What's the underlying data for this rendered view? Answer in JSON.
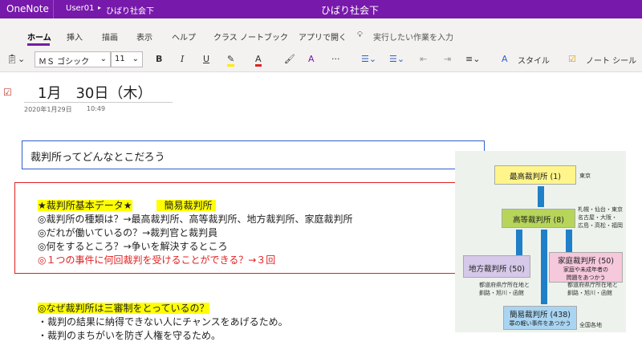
{
  "titlebar": {
    "app": "OneNote",
    "user": "User01",
    "notebook": "ひばり社会下",
    "title": "ひばり社会下"
  },
  "tabs": [
    "ホーム",
    "挿入",
    "描画",
    "表示",
    "ヘルプ",
    "クラス ノートブック",
    "アプリで開く"
  ],
  "search_placeholder": "実行したい作業を入力",
  "toolbar": {
    "font": "ＭＳ ゴシック",
    "size": "11",
    "bold": "B",
    "italic": "I",
    "underline": "U",
    "more": "···",
    "styles": "スタイル",
    "tags": "ノート シール"
  },
  "colors": {
    "accent": "#7719aa",
    "highlight": "#ffff00",
    "red": "#e02020",
    "blue": "#2e5fc9"
  },
  "page": {
    "title": "1月　30日（木）",
    "date": "2020年1月29日",
    "time": "10:49",
    "question": "裁判所ってどんなとこだろう",
    "data_lines": [
      "★裁判所基本データ★",
      "簡易裁判所",
      "◎裁判所の種類は？→最高裁判所、高等裁判所、地方裁判所、家庭裁判所",
      "◎だれが働いているの？→裁判官と裁判員",
      "◎何をするところ？→争いを解決するところ",
      "◎１つの事件に何回裁判を受けることができる？→３回"
    ],
    "why_title": "◎なぜ裁判所は三審制をとっているの？",
    "why_lines": [
      "・裁判の結果に納得できない人にチャンスをあげるため。",
      "・裁判のまちがいを防ぎ人権を守るため。"
    ]
  },
  "diagram": {
    "supreme": "最高裁判所 (1)",
    "supreme_loc": "東京",
    "high": "高等裁判所 (8)",
    "high_loc": [
      "札幌・仙台・東京",
      "名古屋・大阪・",
      "広島・高松・福岡"
    ],
    "district": "地方裁判所 (50)",
    "family": "家庭裁判所 (50)",
    "family_desc": [
      "家庭や未成年者の",
      "問題をあつかう"
    ],
    "district_loc": [
      "都道府県庁所在地と",
      "釧路・旭川・函館"
    ],
    "family_loc": [
      "都道府県庁所在地と",
      "釧路・旭川・函館"
    ],
    "summary": "簡易裁判所 (438)",
    "summary_desc": "罪の軽い事件をあつかう",
    "summary_loc": "全国各地"
  }
}
